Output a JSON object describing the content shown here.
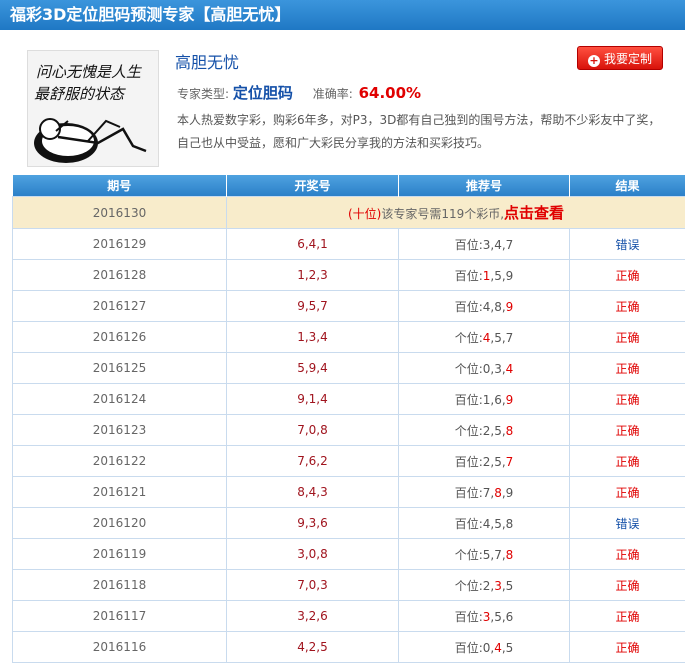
{
  "header": {
    "title": "福彩3D定位胆码预测专家【高胆无忧】"
  },
  "expert": {
    "name": "高胆无忧",
    "avatar_text_line1": "问心无愧是人生",
    "avatar_text_line2": "最舒服的状态",
    "type_label": "专家类型:",
    "type_value": "定位胆码",
    "accuracy_label": "准确率:",
    "accuracy_value": "64.00%",
    "description": "本人热爱数字彩，购彩6年多，对P3，3D都有自己独到的围号方法，帮助不少彩友中了奖，自己也从中受益，愿和广大彩民分享我的方法和买彩技巧。",
    "custom_button": "我要定制"
  },
  "table": {
    "headers": [
      "期号",
      "开奖号",
      "推荐号",
      "结果"
    ],
    "promo": {
      "period": "2016130",
      "position": "(十位)",
      "text": "该专家号需119个彩币,",
      "link": "点击查看"
    },
    "rows": [
      {
        "period": "2016129",
        "draw": "6,4,1",
        "pos": "百位:",
        "rec": [
          "3",
          "4",
          "7"
        ],
        "hit": [],
        "result": "错误",
        "ok": false
      },
      {
        "period": "2016128",
        "draw": "1,2,3",
        "pos": "百位:",
        "rec": [
          "1",
          "5",
          "9"
        ],
        "hit": [
          0
        ],
        "result": "正确",
        "ok": true
      },
      {
        "period": "2016127",
        "draw": "9,5,7",
        "pos": "百位:",
        "rec": [
          "4",
          "8",
          "9"
        ],
        "hit": [
          2
        ],
        "result": "正确",
        "ok": true
      },
      {
        "period": "2016126",
        "draw": "1,3,4",
        "pos": "个位:",
        "rec": [
          "4",
          "5",
          "7"
        ],
        "hit": [
          0
        ],
        "result": "正确",
        "ok": true
      },
      {
        "period": "2016125",
        "draw": "5,9,4",
        "pos": "个位:",
        "rec": [
          "0",
          "3",
          "4"
        ],
        "hit": [
          2
        ],
        "result": "正确",
        "ok": true
      },
      {
        "period": "2016124",
        "draw": "9,1,4",
        "pos": "百位:",
        "rec": [
          "1",
          "6",
          "9"
        ],
        "hit": [
          2
        ],
        "result": "正确",
        "ok": true
      },
      {
        "period": "2016123",
        "draw": "7,0,8",
        "pos": "个位:",
        "rec": [
          "2",
          "5",
          "8"
        ],
        "hit": [
          2
        ],
        "result": "正确",
        "ok": true
      },
      {
        "period": "2016122",
        "draw": "7,6,2",
        "pos": "百位:",
        "rec": [
          "2",
          "5",
          "7"
        ],
        "hit": [
          2
        ],
        "result": "正确",
        "ok": true
      },
      {
        "period": "2016121",
        "draw": "8,4,3",
        "pos": "百位:",
        "rec": [
          "7",
          "8",
          "9"
        ],
        "hit": [
          1
        ],
        "result": "正确",
        "ok": true
      },
      {
        "period": "2016120",
        "draw": "9,3,6",
        "pos": "百位:",
        "rec": [
          "4",
          "5",
          "8"
        ],
        "hit": [],
        "result": "错误",
        "ok": false
      },
      {
        "period": "2016119",
        "draw": "3,0,8",
        "pos": "个位:",
        "rec": [
          "5",
          "7",
          "8"
        ],
        "hit": [
          2
        ],
        "result": "正确",
        "ok": true
      },
      {
        "period": "2016118",
        "draw": "7,0,3",
        "pos": "个位:",
        "rec": [
          "2",
          "3",
          "5"
        ],
        "hit": [
          1
        ],
        "result": "正确",
        "ok": true
      },
      {
        "period": "2016117",
        "draw": "3,2,6",
        "pos": "百位:",
        "rec": [
          "3",
          "5",
          "6"
        ],
        "hit": [
          0
        ],
        "result": "正确",
        "ok": true
      },
      {
        "period": "2016116",
        "draw": "4,2,5",
        "pos": "百位:",
        "rec": [
          "0",
          "4",
          "5"
        ],
        "hit": [
          1
        ],
        "result": "正确",
        "ok": true
      }
    ]
  },
  "colors": {
    "header_blue": "#2a86cf",
    "accent_red": "#e00000",
    "link_blue": "#1450a8",
    "promo_bg": "#f8eccb"
  }
}
